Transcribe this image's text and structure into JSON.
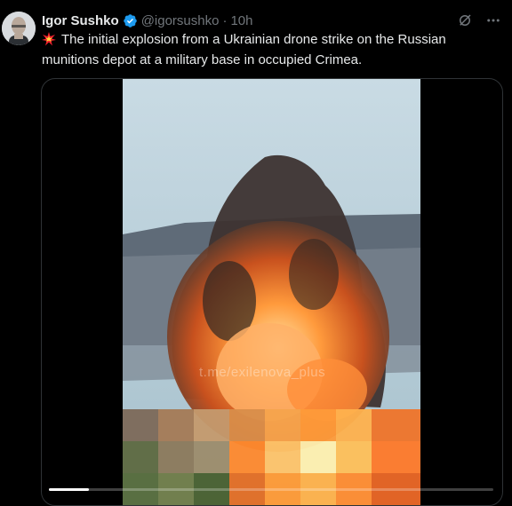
{
  "author": {
    "name": "Igor Sushko",
    "handle": "@igorsushko",
    "separator": "·",
    "time": "10h",
    "verified_icon": "verified-badge-icon"
  },
  "tweet": {
    "emoji_icon": "explosion-emoji-icon",
    "text": "The initial explosion from a Ukrainian drone strike on the Russian munitions depot at a military base in occupied Crimea."
  },
  "media": {
    "watermark": "t.me/exilenova_plus",
    "progress": 0.09
  },
  "colors": {
    "background": "#000000",
    "text": "#e7e9ea",
    "muted": "#71767b",
    "verified": "#1d9bf0",
    "border": "#2f3336"
  },
  "icons": [
    "grok-icon",
    "more-options-icon"
  ]
}
